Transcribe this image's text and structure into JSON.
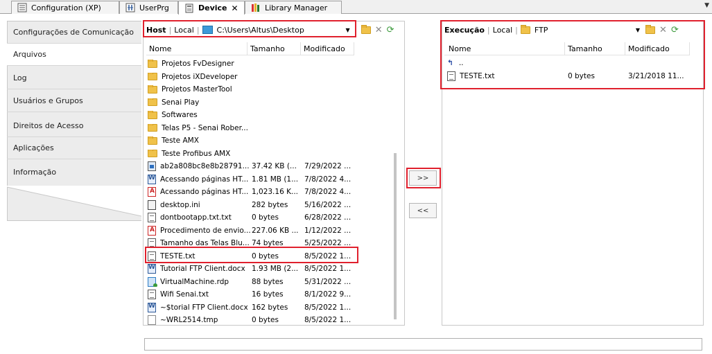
{
  "tabs": [
    {
      "label": "Configuration (XP)",
      "icon": "config-icon",
      "active": false
    },
    {
      "label": "UserPrg",
      "icon": "program-icon",
      "active": false
    },
    {
      "label": "Device",
      "icon": "device-icon",
      "active": true
    },
    {
      "label": "Library Manager",
      "icon": "books-icon",
      "active": false
    }
  ],
  "nav": {
    "items": [
      {
        "label": "Configurações de Comunicação"
      },
      {
        "label": "Arquivos"
      },
      {
        "label": "Log"
      },
      {
        "label": "Usuários e Grupos"
      },
      {
        "label": "Direitos de Acesso"
      },
      {
        "label": "Aplicações"
      },
      {
        "label": "Informação"
      }
    ],
    "selected": "Arquivos"
  },
  "host": {
    "title": "Host",
    "mode": "Local",
    "path": "C:\\Users\\Altus\\Desktop",
    "columns": {
      "name": "Nome",
      "size": "Tamanho",
      "modified": "Modificado"
    },
    "files": [
      {
        "name": "Projetos FvDesigner",
        "size": "",
        "modified": "",
        "icon": "folder-icon"
      },
      {
        "name": "Projetos iXDeveloper",
        "size": "",
        "modified": "",
        "icon": "folder-icon"
      },
      {
        "name": "Projetos MasterTool",
        "size": "",
        "modified": "",
        "icon": "folder-icon"
      },
      {
        "name": "Senai Play",
        "size": "",
        "modified": "",
        "icon": "folder-icon"
      },
      {
        "name": "Softwares",
        "size": "",
        "modified": "",
        "icon": "folder-icon"
      },
      {
        "name": "Telas P5 - Senai Rober...",
        "size": "",
        "modified": "",
        "icon": "folder-icon"
      },
      {
        "name": "Teste AMX",
        "size": "",
        "modified": "",
        "icon": "folder-icon"
      },
      {
        "name": "Teste Profibus AMX",
        "size": "",
        "modified": "",
        "icon": "folder-icon"
      },
      {
        "name": "ab2a808bc8e8b28791...",
        "size": "37.42 KB (...",
        "modified": "7/29/2022 ...",
        "icon": "image-file-icon"
      },
      {
        "name": "Acessando páginas HT...",
        "size": "1.81 MB (1...",
        "modified": "7/8/2022 4...",
        "icon": "word-file-icon"
      },
      {
        "name": "Acessando páginas HT...",
        "size": "1,023.16 K...",
        "modified": "7/8/2022 4...",
        "icon": "pdf-file-icon"
      },
      {
        "name": "desktop.ini",
        "size": "282 bytes",
        "modified": "5/16/2022 ...",
        "icon": "ini-file-icon"
      },
      {
        "name": "dontbootapp.txt.txt",
        "size": "0 bytes",
        "modified": "6/28/2022 ...",
        "icon": "text-file-icon"
      },
      {
        "name": "Procedimento de envio...",
        "size": "227.06 KB ...",
        "modified": "1/12/2022 ...",
        "icon": "pdf-file-icon"
      },
      {
        "name": "Tamanho das Telas Blu...",
        "size": "74 bytes",
        "modified": "5/25/2022 ...",
        "icon": "text-file-icon"
      },
      {
        "name": "TESTE.txt",
        "size": "0 bytes",
        "modified": "8/5/2022 1...",
        "icon": "text-file-icon"
      },
      {
        "name": "Tutorial FTP Client.docx",
        "size": "1.93 MB (2...",
        "modified": "8/5/2022 1...",
        "icon": "word-file-icon"
      },
      {
        "name": "VirtualMachine.rdp",
        "size": "88 bytes",
        "modified": "5/31/2022 ...",
        "icon": "rdp-file-icon"
      },
      {
        "name": "Wifi Senai.txt",
        "size": "16 bytes",
        "modified": "8/1/2022 9...",
        "icon": "text-file-icon"
      },
      {
        "name": "~$torial FTP Client.docx",
        "size": "162 bytes",
        "modified": "8/5/2022 1...",
        "icon": "word-file-icon"
      },
      {
        "name": "~WRL2514.tmp",
        "size": "0 bytes",
        "modified": "8/5/2022 1...",
        "icon": "tmp-file-icon"
      }
    ]
  },
  "transfer": {
    "to_device": ">>",
    "to_host": "<<"
  },
  "exec": {
    "title": "Execução",
    "mode": "Local",
    "path": "FTP",
    "columns": {
      "name": "Nome",
      "size": "Tamanho",
      "modified": "Modificado"
    },
    "up_label": "..",
    "files": [
      {
        "name": "TESTE.txt",
        "size": "0 bytes",
        "modified": "3/21/2018 11...",
        "icon": "text-file-icon"
      }
    ]
  },
  "colors": {
    "highlight": "#e0202d",
    "folder": "#f0c24a"
  }
}
